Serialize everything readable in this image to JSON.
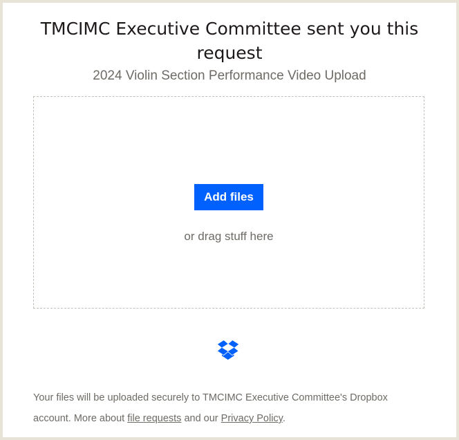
{
  "header": {
    "title": "TMCIMC Executive Committee sent you this request",
    "subtitle": "2024 Violin Section Performance Video Upload"
  },
  "dropzone": {
    "add_files_label": "Add files",
    "drag_text": "or drag stuff here"
  },
  "logo": {
    "icon": "dropbox-logo-icon",
    "color": "#0061fe"
  },
  "footer": {
    "text_part1": "Your files will be uploaded securely to TMCIMC Executive Committee's Dropbox account. More about ",
    "link_file_requests": "file requests",
    "text_part2": " and our ",
    "link_privacy": "Privacy Policy",
    "text_part3": "."
  },
  "colors": {
    "accent": "#0061fe",
    "background": "#e7e3d6",
    "text_primary": "#1e1919",
    "text_secondary": "#6e6a65"
  }
}
